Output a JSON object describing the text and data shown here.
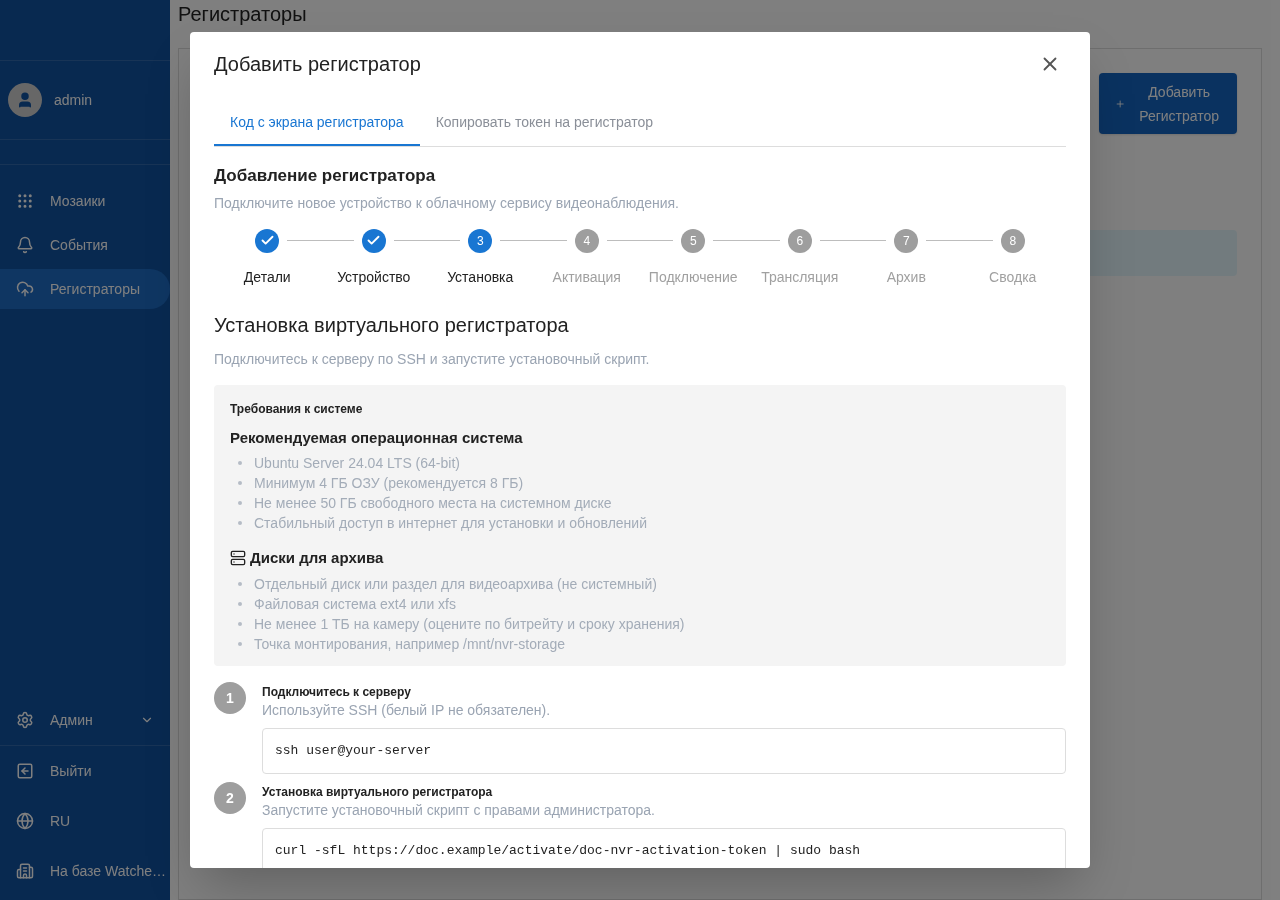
{
  "page": {
    "title": "Регистраторы",
    "add_button": "Добавить Регистратор"
  },
  "sidebar": {
    "user": "admin",
    "items": [
      {
        "label": "Мозаики",
        "selected": false
      },
      {
        "label": "События",
        "selected": false
      },
      {
        "label": "Регистраторы",
        "selected": true
      }
    ],
    "admin": {
      "label": "Админ"
    },
    "bottom": [
      {
        "label": "Выйти"
      },
      {
        "label": "RU"
      },
      {
        "label": "На базе Watche…"
      }
    ]
  },
  "dialog": {
    "title": "Добавить регистратор",
    "tabs": [
      {
        "label": "Код с экрана регистратора",
        "selected": true
      },
      {
        "label": "Копировать токен на регистратор",
        "selected": false
      }
    ],
    "heading": "Добавление регистратора",
    "subtitle": "Подключите новое устройство к облачному сервису видеонаблюдения.",
    "steps": [
      {
        "label": "Детали",
        "completed": true
      },
      {
        "label": "Устройство",
        "completed": true
      },
      {
        "number": "3",
        "label": "Установка",
        "completed": false,
        "active": true
      },
      {
        "number": "4",
        "label": "Активация",
        "completed": false,
        "active": false
      },
      {
        "number": "5",
        "label": "Подключение",
        "completed": false,
        "active": false
      },
      {
        "number": "6",
        "label": "Трансляция",
        "completed": false,
        "active": false
      },
      {
        "number": "7",
        "label": "Архив",
        "completed": false,
        "active": false
      },
      {
        "number": "8",
        "label": "Сводка",
        "completed": false,
        "active": false
      }
    ],
    "section_title": "Установка виртуального регистратора",
    "section_hint": "Подключитесь к серверу по SSH и запустите установочный скрипт.",
    "requirements": {
      "title": "Требования к системе",
      "groups": [
        {
          "title": "Рекомендуемая операционная система",
          "items": [
            "Ubuntu Server 24.04 LTS (64-bit)",
            "Минимум 4 ГБ ОЗУ (рекомендуется 8 ГБ)",
            "Не менее 50 ГБ свободного места на системном диске",
            "Стабильный доступ в интернет для установки и обновлений"
          ]
        },
        {
          "title": "Диски для архива",
          "items": [
            "Отдельный диск или раздел для видеоархива (не системный)",
            "Файловая система ext4 или xfs",
            "Не менее 1 ТБ на камеру (оцените по битрейту и сроку хранения)",
            "Точка монтирования, например /mnt/nvr-storage"
          ]
        }
      ]
    },
    "instructions": [
      {
        "number": "1",
        "title": "Подключитесь к серверу",
        "hint": "Используйте SSH (белый IP не обязателен).",
        "code": "ssh user@your-server"
      },
      {
        "number": "2",
        "title": "Установка виртуального регистратора",
        "hint": "Запустите установочный скрипт с правами администратора.",
        "code": "curl -sfL https://doc.example/activate/doc-nvr-activation-token | sudo bash"
      }
    ]
  }
}
